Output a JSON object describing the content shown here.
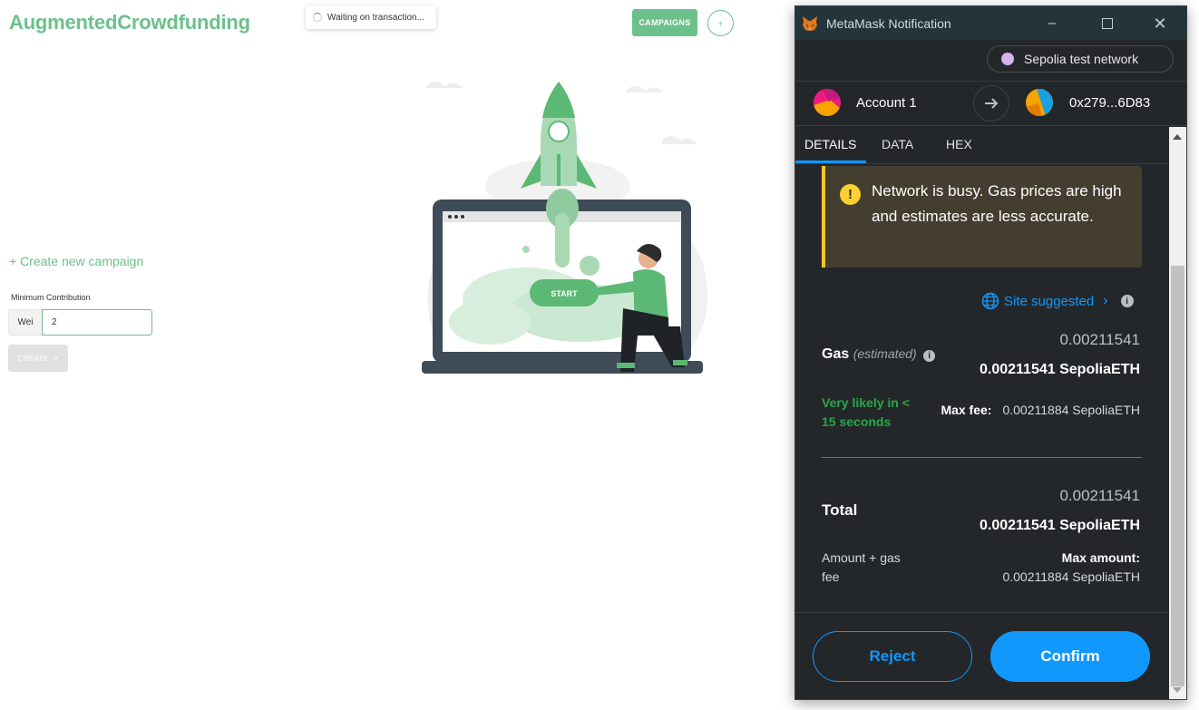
{
  "app": {
    "brand": "AugmentedCrowdfunding",
    "toast": "Waiting on transaction...",
    "campaigns_button": "CAMPAIGNS",
    "plus_button": "+",
    "create_link": "+ Create new campaign",
    "min_label": "Minimum Contribution",
    "unit": "Wei",
    "amount_value": "2",
    "create_button": "CREATE",
    "illustration_button": "START",
    "brand_color": "#6cc08b"
  },
  "metamask": {
    "title": "MetaMask Notification",
    "network": "Sepolia test network",
    "account_name": "Account 1",
    "recipient": "0x279...6D83",
    "tabs": [
      "DETAILS",
      "DATA",
      "HEX"
    ],
    "warning": "Network is busy. Gas prices are high and estimates are less accurate.",
    "site_suggested": "Site suggested",
    "gas_label": "Gas",
    "gas_estimated": "(estimated)",
    "gas_small": "0.00211541",
    "gas_big": "0.00211541 SepoliaETH",
    "likely": "Very likely in < 15 seconds",
    "max_fee_label": "Max fee:",
    "max_fee_value": "0.00211884 SepoliaETH",
    "total_label": "Total",
    "total_small": "0.00211541",
    "total_big": "0.00211541 SepoliaETH",
    "amount_gas_label": "Amount + gas fee",
    "max_amount_label": "Max amount:",
    "max_amount_value": "0.00211884 SepoliaETH",
    "reject": "Reject",
    "confirm": "Confirm",
    "accent_color": "#1098fc"
  }
}
